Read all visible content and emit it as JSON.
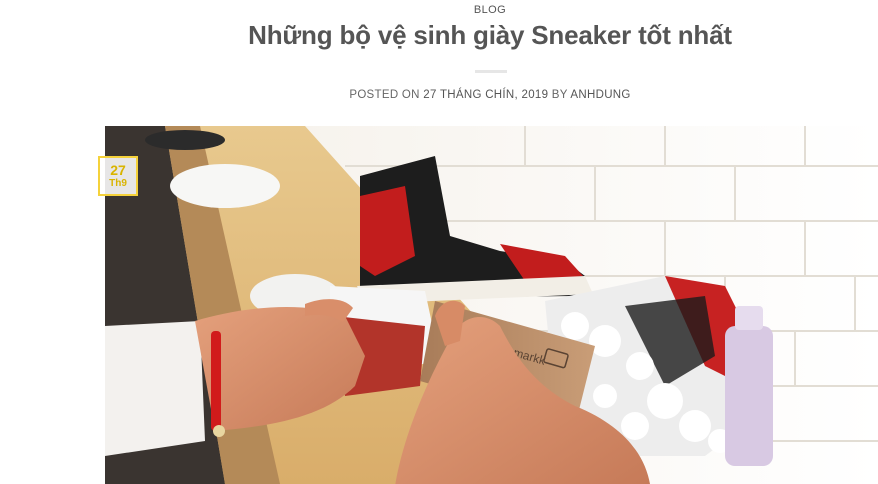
{
  "post": {
    "category": "BLOG",
    "title": "Những bộ vệ sinh giày Sneaker tốt nhất",
    "meta": {
      "posted_on_label": "POSTED ON",
      "date": "27 THÁNG CHÍN, 2019",
      "by_label": "BY",
      "author": "ANHDUNG"
    },
    "badge": {
      "day": "27",
      "month": "Th9"
    },
    "image": {
      "brand_on_brush": "jasonmarkk"
    }
  },
  "colors": {
    "accent": "#f5d23b",
    "title": "#555555"
  }
}
